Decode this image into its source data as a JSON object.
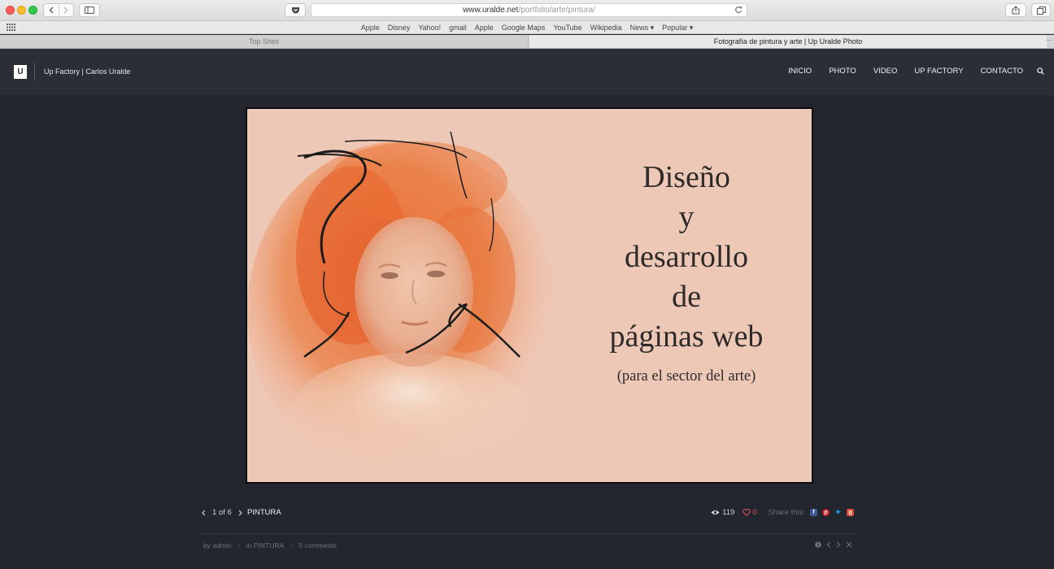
{
  "browser": {
    "url_host": "www.uralde.net",
    "url_path": "/portfolio/arte/pintura/",
    "favorites": [
      "Apple",
      "Disney",
      "Yahoo!",
      "gmail",
      "Apple",
      "Google Maps",
      "YouTube",
      "Wikipedia",
      "News ▾",
      "Popular ▾"
    ],
    "tabs": [
      {
        "label": "Top Sites",
        "active": false
      },
      {
        "label": "Fotografía de pintura y arte | Up Uralde Photo",
        "active": true
      }
    ]
  },
  "site": {
    "logo_text": "U",
    "title": "Up Factory | Carlos Uralde",
    "nav": [
      "INICIO",
      "PHOTO",
      "VIDEO",
      "UP FACTORY",
      "CONTACTO"
    ]
  },
  "hero": {
    "lines": [
      "Diseño",
      "y",
      "desarrollo",
      "de",
      "páginas web"
    ],
    "subtitle": "(para el sector del arte)"
  },
  "post": {
    "pager": "1 of 6",
    "category": "PINTURA",
    "views": "119",
    "likes": "0",
    "share_label": "Share this:",
    "by": "by admin",
    "in": "in PINTURA",
    "comments": "0 comments"
  },
  "colors": {
    "page_bg": "#23262e",
    "header_bg": "#2b2e36",
    "like_red": "#e05a5a",
    "facebook": "#3b5998",
    "pinterest": "#cb2027",
    "twitter": "#1da1f2",
    "googleplus": "#dd4b39"
  }
}
